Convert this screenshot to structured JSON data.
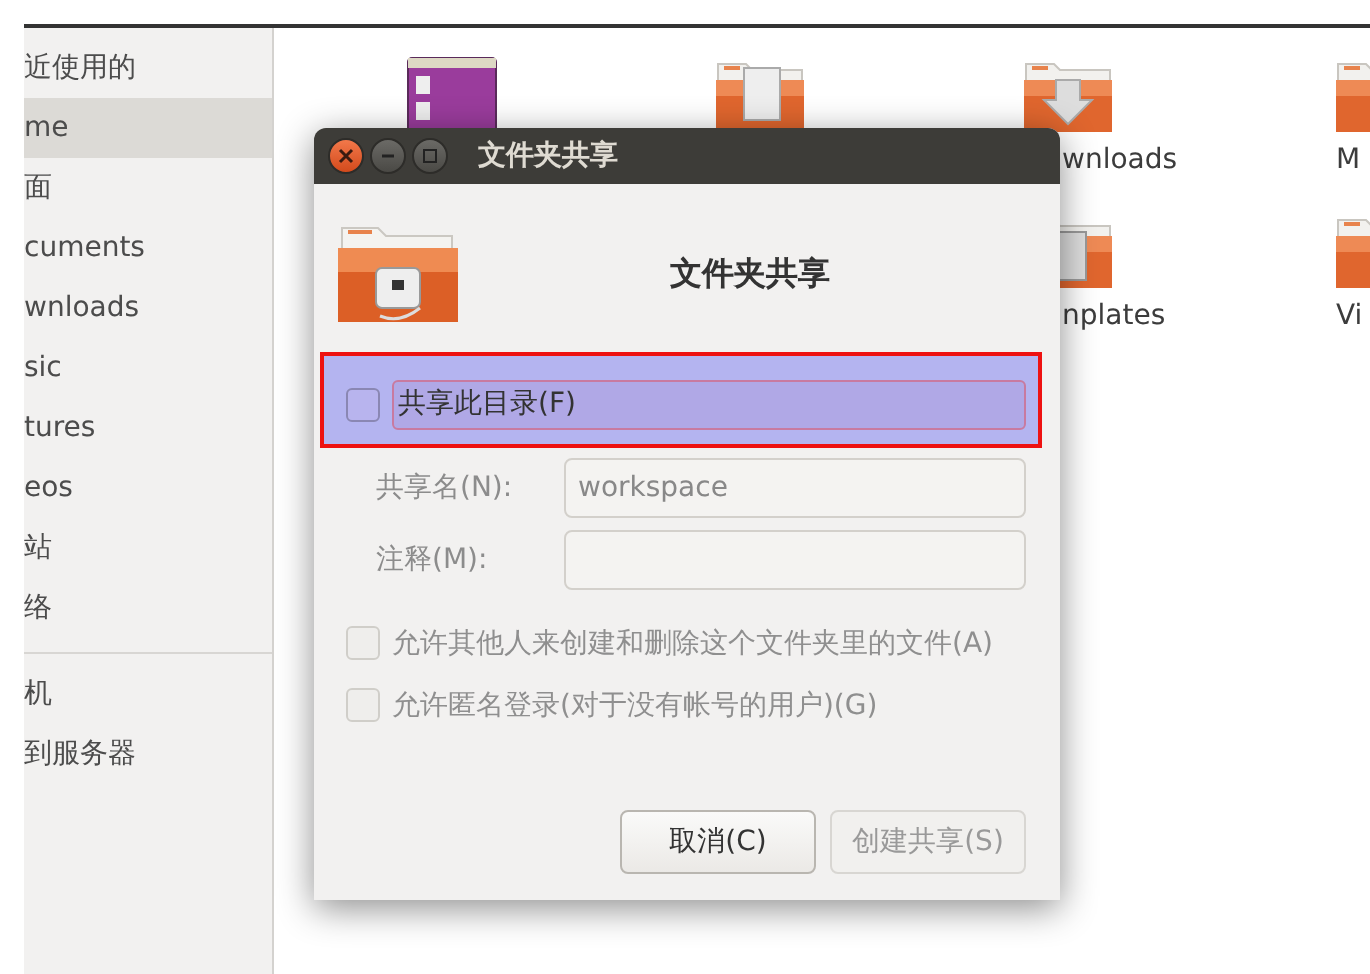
{
  "sidebar": {
    "items": [
      {
        "label": "近使用的",
        "selected": false
      },
      {
        "label": "me",
        "selected": true
      },
      {
        "label": "面",
        "selected": false
      },
      {
        "label": "cuments",
        "selected": false
      },
      {
        "label": "wnloads",
        "selected": false
      },
      {
        "label": "sic",
        "selected": false
      },
      {
        "label": "tures",
        "selected": false
      },
      {
        "label": "eos",
        "selected": false
      },
      {
        "label": "站",
        "selected": false
      },
      {
        "label": "络",
        "selected": false
      }
    ],
    "network_items": [
      {
        "label": "机",
        "selected": false
      },
      {
        "label": "到服务器",
        "selected": false
      }
    ]
  },
  "files": {
    "row_1": [
      {
        "kind": "desktop"
      },
      {
        "kind": "documents"
      },
      {
        "kind": "downloads",
        "label": "wnloads"
      },
      {
        "kind": "folder",
        "label": "M"
      }
    ],
    "row_2": [
      {
        "kind": "templates",
        "label": "nplates"
      },
      {
        "kind": "folder",
        "label": "Vi"
      }
    ]
  },
  "dialog": {
    "title": "文件夹共享",
    "heading": "文件夹共享",
    "share_checkbox": {
      "label": "共享此目录(F)",
      "checked": false,
      "highlighted": true
    },
    "fields": [
      {
        "label": "共享名(N):",
        "value": "workspace",
        "disabled": true
      },
      {
        "label": "注释(M):",
        "disabled": true
      }
    ],
    "options": [
      {
        "label": "允许其他人来创建和删除这个文件夹里的文件(A)",
        "checked": false,
        "disabled": true
      },
      {
        "label": "允许匿名登录(对于没有帐号的用户)(G)",
        "checked": false,
        "disabled": true
      }
    ],
    "buttons": [
      {
        "label": "取消(C)",
        "disabled": false
      },
      {
        "label": "创建共享(S)",
        "disabled": true
      }
    ]
  }
}
